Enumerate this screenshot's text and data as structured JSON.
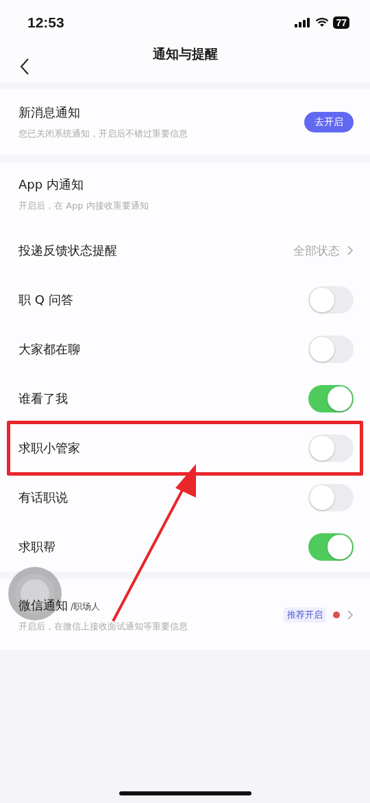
{
  "status_bar": {
    "time": "12:53",
    "battery": "77"
  },
  "nav": {
    "title": "通知与提醒"
  },
  "sections": [
    {
      "items": [
        {
          "kind": "action",
          "title": "新消息通知",
          "subtitle": "您已关闭系统通知，开启后不错过重要信息",
          "button": "去开启"
        }
      ]
    },
    {
      "items": [
        {
          "kind": "info",
          "title": "App 内通知",
          "subtitle": "开启后，在 App 内接收重要通知"
        },
        {
          "kind": "link",
          "title": "投递反馈状态提醒",
          "value": "全部状态"
        },
        {
          "kind": "toggle",
          "title": "职 Q 问答",
          "on": false,
          "highlighted": false
        },
        {
          "kind": "toggle",
          "title": "大家都在聊",
          "on": false,
          "highlighted": false
        },
        {
          "kind": "toggle",
          "title": "谁看了我",
          "on": true,
          "highlighted": false
        },
        {
          "kind": "toggle",
          "title": "求职小管家",
          "on": false,
          "highlighted": true
        },
        {
          "kind": "toggle",
          "title": "有话职说",
          "on": false,
          "highlighted": false
        },
        {
          "kind": "toggle",
          "title": "求职帮",
          "on": true,
          "highlighted": false
        }
      ]
    },
    {
      "items": [
        {
          "kind": "badge_link",
          "title": "微信通知",
          "suffix": "/职场人",
          "subtitle": "开启后，在微信上接收面试通知等重要信息",
          "badge": "推荐开启",
          "dot": true
        }
      ]
    }
  ]
}
